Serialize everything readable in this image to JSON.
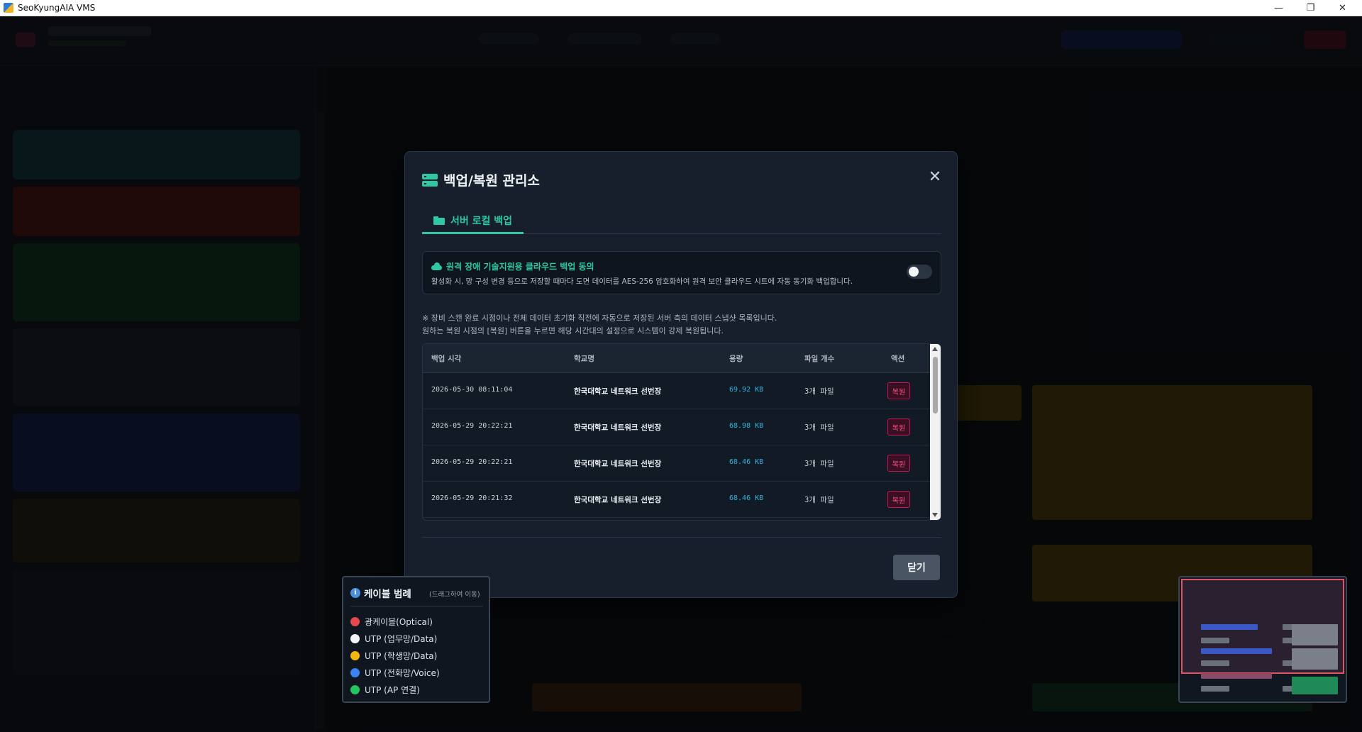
{
  "window": {
    "title": "SeoKyungAIA VMS",
    "controls": {
      "minimize": "—",
      "maximize": "❐",
      "close": "✕"
    }
  },
  "modal": {
    "title": "백업/복원 관리소",
    "close_icon": "✕",
    "tab": {
      "label": "서버 로컬 백업"
    },
    "consent": {
      "title": "원격 장애 기술지원용 클라우드 백업 동의",
      "description": "활성화 시, 망 구성 변경 등으로 저장할 때마다 도면 데이터를 AES-256 암호화하여 원격 보안 클라우드 시트에 자동 동기화 백업합니다.",
      "enabled": false
    },
    "notes": [
      "※ 장비 스캔 완료 시점이나 전체 데이터 초기화 직전에 자동으로 저장된 서버 측의 데이터 스냅샷 목록입니다.",
      "원하는 복원 시점의 [복원] 버튼을 누르면 해당 시간대의 설정으로 시스템이 강제 복원됩니다."
    ],
    "table": {
      "headers": {
        "time": "백업 시각",
        "school": "학교명",
        "size": "용량",
        "files": "파일 개수",
        "action": "액션"
      },
      "rows": [
        {
          "time": "2026-05-30 08:11:04",
          "school": "한국대학교 네트워크 선번장",
          "size": "69.92 KB",
          "files": "3개 파일",
          "action": "복원"
        },
        {
          "time": "2026-05-29 20:22:21",
          "school": "한국대학교 네트워크 선번장",
          "size": "68.98 KB",
          "files": "3개 파일",
          "action": "복원"
        },
        {
          "time": "2026-05-29 20:22:21",
          "school": "한국대학교 네트워크 선번장",
          "size": "68.46 KB",
          "files": "3개 파일",
          "action": "복원"
        },
        {
          "time": "2026-05-29 20:21:32",
          "school": "한국대학교 네트워크 선번장",
          "size": "68.46 KB",
          "files": "3개 파일",
          "action": "복원"
        }
      ]
    },
    "close_button": "닫기"
  },
  "legend": {
    "icon": "info-icon",
    "title": "케이블 범례",
    "hint": "(드래그하여 이동)",
    "items": [
      {
        "label": "광케이블(Optical)",
        "color": "#e5484d"
      },
      {
        "label": "UTP (업무망/Data)",
        "color": "#f2f4f7"
      },
      {
        "label": "UTP (학생망/Data)",
        "color": "#f5b70a"
      },
      {
        "label": "UTP (전화망/Voice)",
        "color": "#3b82f6"
      },
      {
        "label": "UTP (AP 연결)",
        "color": "#22c55e"
      }
    ]
  },
  "colors": {
    "accent": "#2ec9a0",
    "restore": "#ff4f8b",
    "size_text": "#2fb5e0"
  }
}
